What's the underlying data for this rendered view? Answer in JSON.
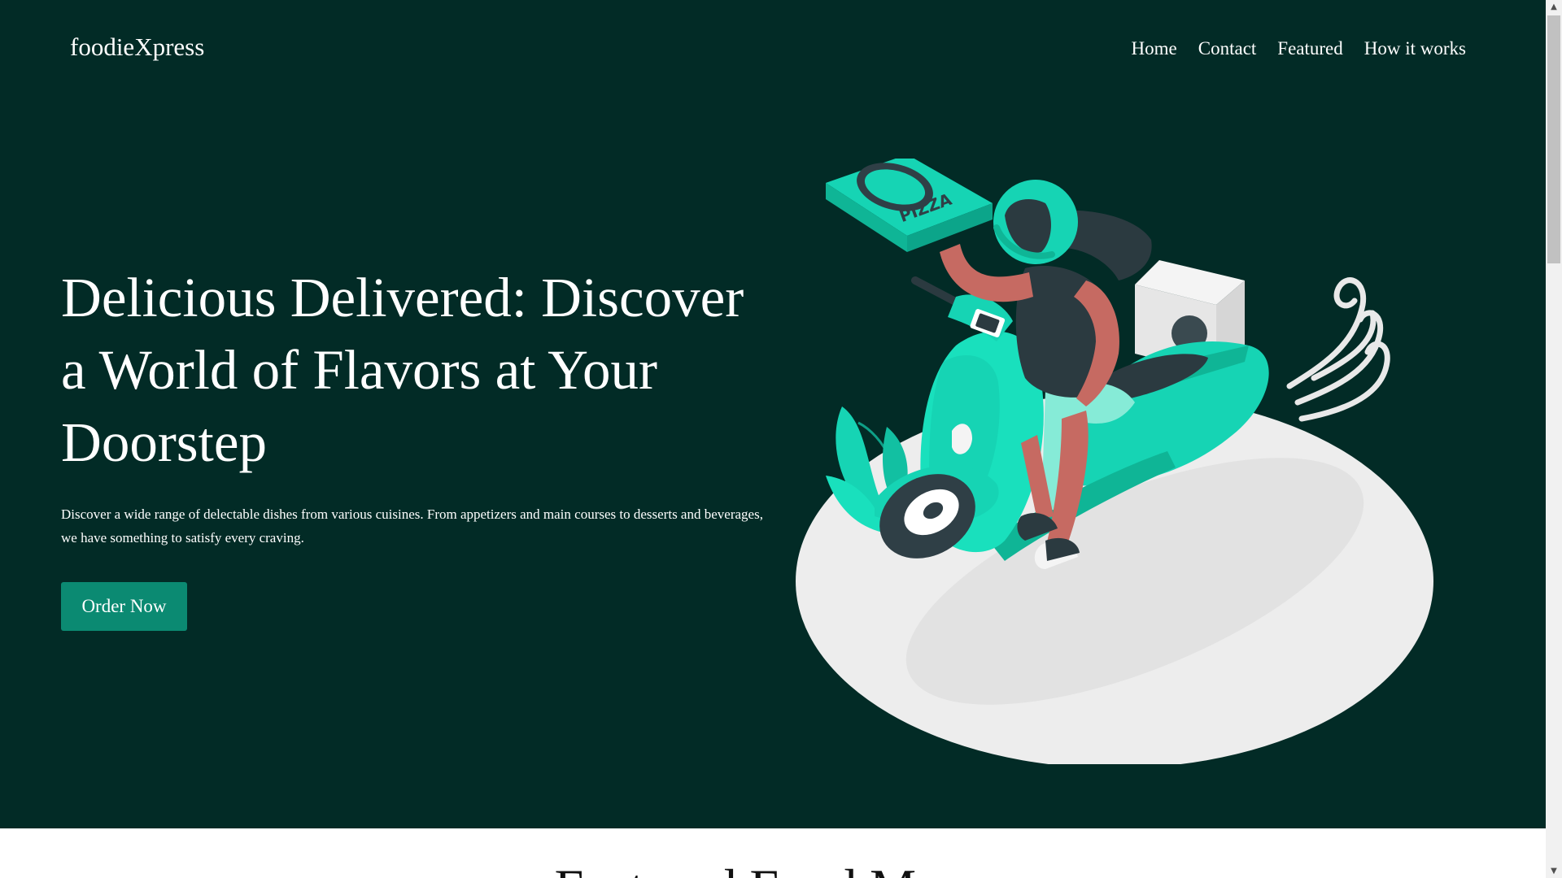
{
  "brand": "foodieXpress",
  "nav": {
    "items": [
      {
        "label": "Home"
      },
      {
        "label": "Contact"
      },
      {
        "label": "Featured"
      },
      {
        "label": "How it works"
      }
    ]
  },
  "hero": {
    "headline": "Delicious Delivered: Discover a World of Flavors at Your Doorstep",
    "subtext": "Discover a wide range of delectable dishes from various cuisines. From appetizers and main courses to desserts and beverages, we have something to satisfy every craving.",
    "cta_label": "Order Now",
    "illustration": {
      "box_text": "PIZZA",
      "icon": "scooter-delivery-illustration"
    }
  },
  "next_section": {
    "title": "Featured Food Menu"
  },
  "scrollbar": {
    "up_icon": "▲",
    "down_icon": "▼"
  },
  "colors": {
    "hero_background": "#022b26",
    "accent": "#0b8a72",
    "scooter_teal": "#16d4b4",
    "text": "#ffffff"
  }
}
